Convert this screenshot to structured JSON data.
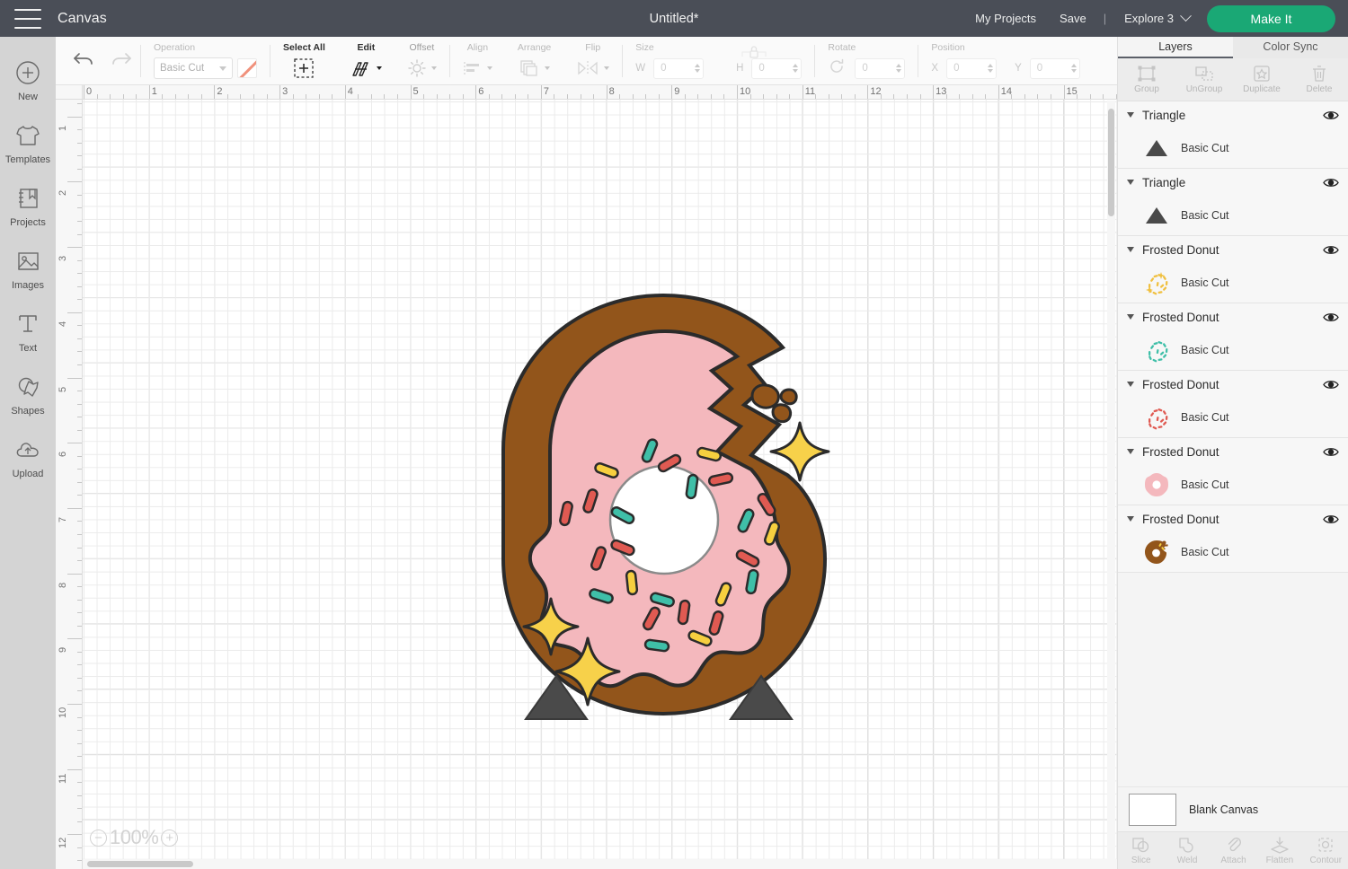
{
  "header": {
    "menu_icon": "hamburger-icon",
    "canvas_label": "Canvas",
    "document_title": "Untitled*",
    "my_projects": "My Projects",
    "save": "Save",
    "separator": "|",
    "machine": "Explore 3",
    "make_it": "Make It",
    "bg_color": "#4a4e57",
    "accent_color": "#1aa875"
  },
  "sidebar": {
    "items": [
      {
        "label": "New",
        "icon": "plus-circle-icon"
      },
      {
        "label": "Templates",
        "icon": "tshirt-icon"
      },
      {
        "label": "Projects",
        "icon": "book-bookmark-icon"
      },
      {
        "label": "Images",
        "icon": "photo-icon"
      },
      {
        "label": "Text",
        "icon": "text-T-icon"
      },
      {
        "label": "Shapes",
        "icon": "star-shape-icon"
      },
      {
        "label": "Upload",
        "icon": "cloud-upload-icon"
      }
    ]
  },
  "toolbar": {
    "undo": "undo-icon",
    "redo": "redo-icon",
    "operation_label": "Operation",
    "operation_value": "Basic Cut",
    "color_swatch": "#f0917c",
    "select_all": "Select All",
    "edit": "Edit",
    "offset": "Offset",
    "align": "Align",
    "arrange": "Arrange",
    "flip": "Flip",
    "size_label": "Size",
    "width_label": "W",
    "width_value": "0",
    "height_label": "H",
    "height_value": "0",
    "lock_icon": "lock-icon",
    "rotate_label": "Rotate",
    "rotate_value": "0",
    "position_label": "Position",
    "x_label": "X",
    "x_value": "0",
    "y_label": "Y",
    "y_value": "0"
  },
  "canvas": {
    "zoom_level": "100%",
    "zoom_out": "−",
    "zoom_in": "+",
    "ruler_h_max": 16,
    "ruler_v_max": 12,
    "ruler_unit": "inches"
  },
  "right_panel": {
    "tabs": [
      {
        "label": "Layers",
        "active": true
      },
      {
        "label": "Color Sync",
        "active": false
      }
    ],
    "tools": [
      {
        "label": "Group",
        "icon": "group-icon"
      },
      {
        "label": "UnGroup",
        "icon": "ungroup-icon"
      },
      {
        "label": "Duplicate",
        "icon": "duplicate-icon"
      },
      {
        "label": "Delete",
        "icon": "trash-icon"
      }
    ],
    "layers": [
      {
        "name": "Triangle",
        "operation": "Basic Cut",
        "thumb": "triangle",
        "color": "#4a4a4a",
        "visible": true
      },
      {
        "name": "Triangle",
        "operation": "Basic Cut",
        "thumb": "triangle",
        "color": "#4a4a4a",
        "visible": true
      },
      {
        "name": "Frosted Donut",
        "operation": "Basic Cut",
        "thumb": "sprinkles",
        "color": "#f0c040",
        "visible": true
      },
      {
        "name": "Frosted Donut",
        "operation": "Basic Cut",
        "thumb": "sprinkles",
        "color": "#3fbfa8",
        "visible": true
      },
      {
        "name": "Frosted Donut",
        "operation": "Basic Cut",
        "thumb": "sprinkles",
        "color": "#e05a52",
        "visible": true
      },
      {
        "name": "Frosted Donut",
        "operation": "Basic Cut",
        "thumb": "frosting-ring",
        "color": "#f4b8bd",
        "visible": true
      },
      {
        "name": "Frosted Donut",
        "operation": "Basic Cut",
        "thumb": "donut-base",
        "color": "#92551b",
        "visible": true
      }
    ],
    "blank_canvas": "Blank Canvas",
    "bottom_tools": [
      {
        "label": "Slice",
        "icon": "slice-icon"
      },
      {
        "label": "Weld",
        "icon": "weld-icon"
      },
      {
        "label": "Attach",
        "icon": "paperclip-icon"
      },
      {
        "label": "Flatten",
        "icon": "flatten-icon"
      },
      {
        "label": "Contour",
        "icon": "contour-icon"
      }
    ]
  },
  "artwork": {
    "title": "Frosted Donut with bite",
    "donut_base_color": "#92551b",
    "frosting_color": "#f4b8bd",
    "outline_color": "#2b2b2b",
    "sparkle_color": "#f7d14a",
    "triangle_color": "#4a4a4a",
    "sprinkle_colors": [
      "#e05a52",
      "#3fbfa8",
      "#f6cf3f"
    ]
  }
}
